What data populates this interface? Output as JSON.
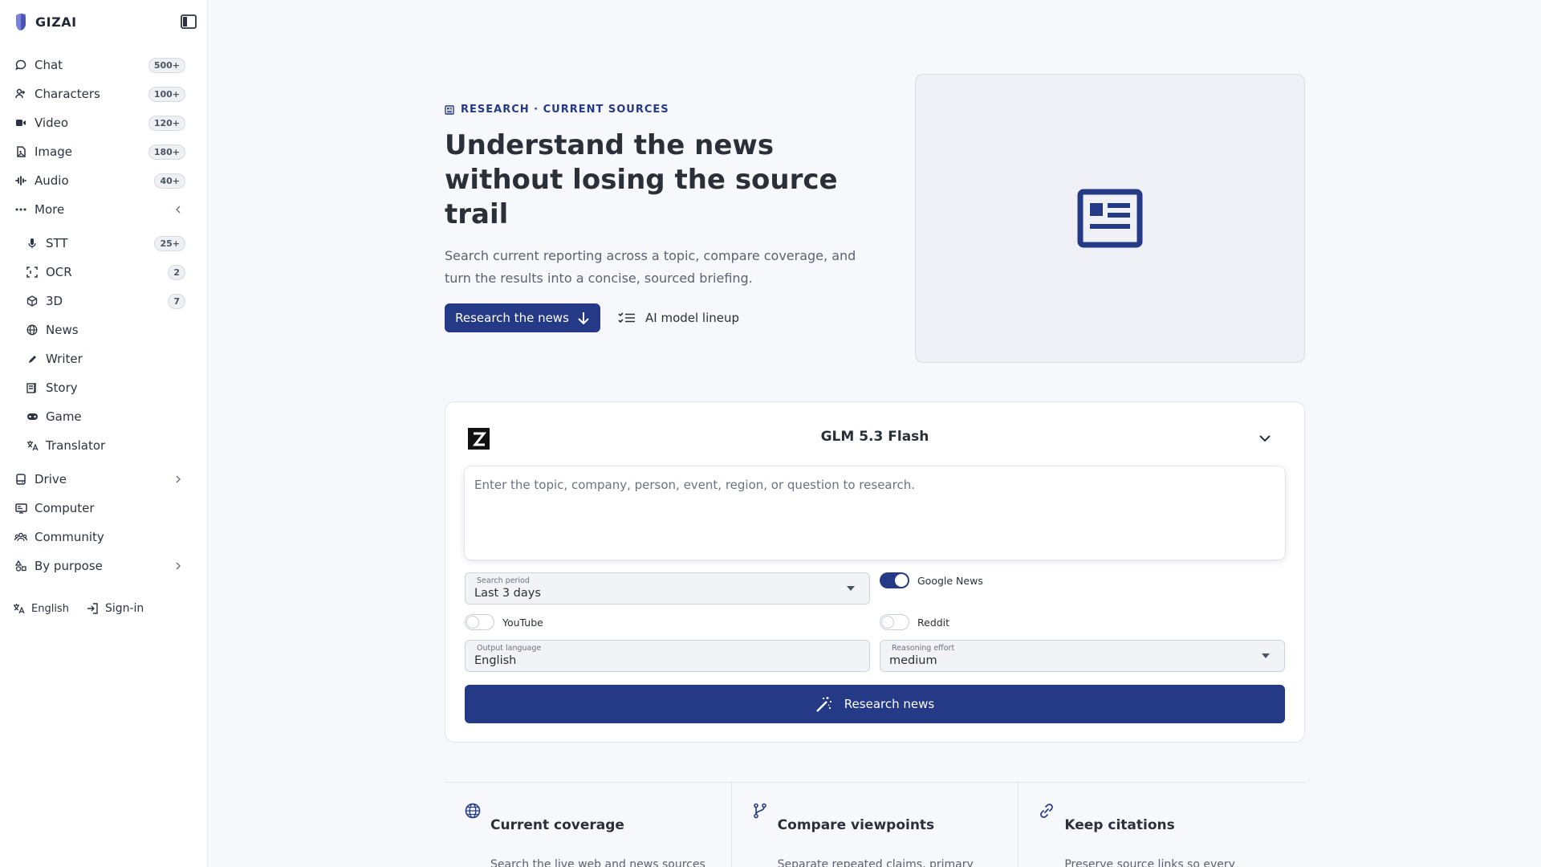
{
  "brand": {
    "name": "GIZAI"
  },
  "sidebar": {
    "items": [
      {
        "label": "Chat",
        "badge": "500+",
        "icon": "chat-bubble-icon"
      },
      {
        "label": "Characters",
        "badge": "100+",
        "icon": "users-icon"
      },
      {
        "label": "Video",
        "badge": "120+",
        "icon": "video-camera-icon"
      },
      {
        "label": "Image",
        "badge": "180+",
        "icon": "image-icon"
      },
      {
        "label": "Audio",
        "badge": "40+",
        "icon": "audio-wave-icon"
      },
      {
        "label": "More",
        "icon": "ellipsis-icon"
      }
    ],
    "more_items": [
      {
        "label": "STT",
        "badge": "25+",
        "icon": "microphone-icon"
      },
      {
        "label": "OCR",
        "badge": "2",
        "icon": "scan-icon"
      },
      {
        "label": "3D",
        "badge": "7",
        "icon": "cube-icon"
      },
      {
        "label": "News",
        "icon": "globe-icon"
      },
      {
        "label": "Writer",
        "icon": "pen-icon"
      },
      {
        "label": "Story",
        "icon": "book-icon"
      },
      {
        "label": "Game",
        "icon": "gamepad-icon"
      },
      {
        "label": "Translator",
        "icon": "translate-icon"
      }
    ],
    "bottom_items": [
      {
        "label": "Drive",
        "icon": "drive-icon"
      },
      {
        "label": "Computer",
        "icon": "monitor-icon"
      },
      {
        "label": "Community",
        "icon": "community-icon"
      },
      {
        "label": "By purpose",
        "icon": "shapes-icon"
      }
    ],
    "footer": {
      "language": "English",
      "signin": "Sign-in"
    }
  },
  "hero": {
    "eyebrow": "RESEARCH · CURRENT SOURCES",
    "title": "Understand the news without losing the source trail",
    "description": "Search current reporting across a topic, compare coverage, and turn the results into a concise, sourced briefing.",
    "primary_button": "Research the news",
    "secondary_button": "AI model lineup"
  },
  "form": {
    "model": "GLM 5.3 Flash",
    "prompt_placeholder": "Enter the topic, company, person, event, region, or question to research.",
    "search_period": {
      "label": "Search period",
      "value": "Last 3 days"
    },
    "toggles": {
      "google_news": {
        "label": "Google News",
        "on": true
      },
      "youtube": {
        "label": "YouTube",
        "on": false
      },
      "reddit": {
        "label": "Reddit",
        "on": false
      }
    },
    "output_language": {
      "label": "Output language",
      "value": "English"
    },
    "reasoning_effort": {
      "label": "Reasoning effort",
      "value": "medium"
    },
    "submit": "Research news"
  },
  "features": [
    {
      "title": "Current coverage",
      "desc": "Search the live web and news sources",
      "icon": "globe-icon"
    },
    {
      "title": "Compare viewpoints",
      "desc": "Separate repeated claims, primary",
      "icon": "branch-icon"
    },
    {
      "title": "Keep citations",
      "desc": "Preserve source links so every",
      "icon": "link-icon"
    }
  ],
  "colors": {
    "accent": "#243a86",
    "background": "#f7f8fb"
  }
}
